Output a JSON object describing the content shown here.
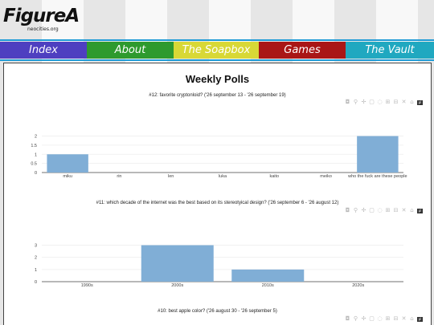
{
  "site": {
    "logo_text": "FigureA",
    "logo_sub": "neocities.org"
  },
  "nav": [
    {
      "label": "Index",
      "color": "#4e3fc0",
      "text_color": "#ffffff"
    },
    {
      "label": "About",
      "color": "#2e9a2e",
      "text_color": "#ffffff"
    },
    {
      "label": "The Soapbox",
      "color": "#d8d836",
      "text_color": "#ffffff"
    },
    {
      "label": "Games",
      "color": "#a91616",
      "text_color": "#ffffff"
    },
    {
      "label": "The Vault",
      "color": "#20a8c0",
      "text_color": "#ffffff"
    }
  ],
  "page": {
    "title": "Weekly Polls"
  },
  "toolbar_icons": [
    "camera-icon",
    "zoom-icon",
    "pan-icon",
    "box-select-icon",
    "lasso-icon",
    "zoom-in-icon",
    "zoom-out-icon",
    "autoscale-icon",
    "reset-icon",
    "plotly-logo-icon"
  ],
  "colors": {
    "bar": "#80aed6",
    "grid": "#eeeeee"
  },
  "chart_data": [
    {
      "type": "bar",
      "title": "#12: favorite cryptonloid? ('26 september 13 - '26 september 19)",
      "categories": [
        "miku",
        "rin",
        "len",
        "luka",
        "kaito",
        "meiko",
        "who the fuck are these people"
      ],
      "values": [
        1,
        0,
        0,
        0,
        0,
        0,
        2
      ],
      "ylim": [
        0,
        2.2
      ],
      "yticks": [
        "0",
        "0.5",
        "1",
        "1.5",
        "2"
      ],
      "xlabel": "",
      "ylabel": ""
    },
    {
      "type": "bar",
      "title": "#11: which decade of the internet was the best based on its stereotyical design? ('26 september 6 - '26 august 12)",
      "categories": [
        "1990s",
        "2000s",
        "2010s",
        "2020s"
      ],
      "values": [
        0,
        3,
        1,
        0
      ],
      "ylim": [
        0,
        3.3
      ],
      "yticks": [
        "0",
        "1",
        "2",
        "3"
      ],
      "xlabel": "",
      "ylabel": ""
    },
    {
      "type": "bar",
      "title": "#10: best apple color? ('26 august 30 - '26 september 5)",
      "categories": [],
      "values": []
    }
  ]
}
